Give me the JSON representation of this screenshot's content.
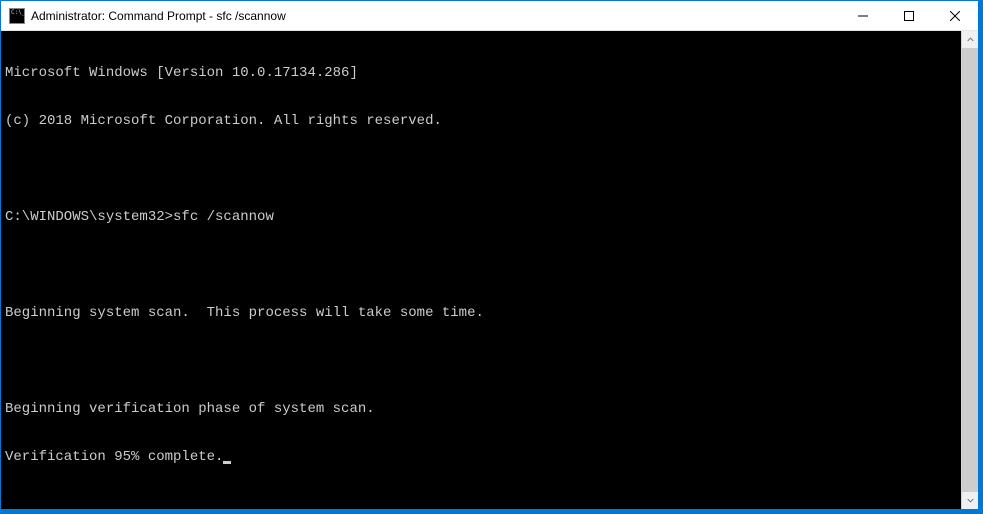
{
  "window": {
    "title": "Administrator: Command Prompt - sfc  /scannow"
  },
  "console": {
    "lines": [
      "Microsoft Windows [Version 10.0.17134.286]",
      "(c) 2018 Microsoft Corporation. All rights reserved.",
      "",
      "C:\\WINDOWS\\system32>sfc /scannow",
      "",
      "Beginning system scan.  This process will take some time.",
      "",
      "Beginning verification phase of system scan.",
      "Verification 95% complete."
    ]
  }
}
